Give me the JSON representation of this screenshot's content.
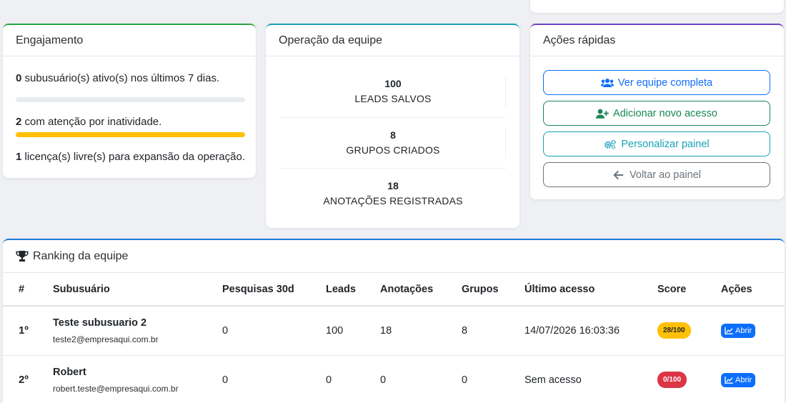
{
  "engagement": {
    "title": "Engajamento",
    "active": {
      "count": "0",
      "text": " subusuário(s) ativo(s) nos últimos 7 dias.",
      "progress": 0,
      "color": "#e9ecef"
    },
    "attention": {
      "count": "2",
      "text": " com atenção por inatividade.",
      "progress": 1,
      "color": "#ffc107"
    },
    "licenses": {
      "count": "1",
      "text": " licença(s) livre(s) para expansão da operação."
    }
  },
  "operation": {
    "title": "Operação da equipe",
    "stats": [
      {
        "value": "100",
        "label": "LEADS SALVOS"
      },
      {
        "value": "8",
        "label": "GRUPOS CRIADOS"
      },
      {
        "value": "18",
        "label": "ANOTAÇÕES REGISTRADAS"
      }
    ]
  },
  "actions": {
    "title": "Ações rápidas",
    "buttons": [
      {
        "label": "Ver equipe completa",
        "icon": "users-icon",
        "color": "#0d6efd"
      },
      {
        "label": "Adicionar novo acesso",
        "icon": "user-plus-icon",
        "color": "#198754"
      },
      {
        "label": "Personalizar painel",
        "icon": "cogs-icon",
        "color": "#17a2b8"
      },
      {
        "label": "Voltar ao painel",
        "icon": "arrow-left-icon",
        "color": "#6c757d"
      }
    ]
  },
  "ranking": {
    "title": "Ranking da equipe",
    "icon": "trophy-icon",
    "columns": [
      "#",
      "Subusuário",
      "Pesquisas 30d",
      "Leads",
      "Anotações",
      "Grupos",
      "Último acesso",
      "Score",
      "Ações"
    ],
    "rows": [
      {
        "pos": "1º",
        "name": "Teste subusuario 2",
        "email": "teste2@empresaqui.com.br",
        "searches": "0",
        "leads": "100",
        "notes": "18",
        "groups": "8",
        "last": "14/07/2026 16:03:36",
        "score": "28/100",
        "score_color": "#ffc107",
        "score_text_color": "#212529",
        "action": "Abrir"
      },
      {
        "pos": "2º",
        "name": "Robert",
        "email": "robert.teste@empresaqui.com.br",
        "searches": "0",
        "leads": "0",
        "notes": "0",
        "groups": "0",
        "last": "Sem acesso",
        "score": "0/100",
        "score_color": "#dc3545",
        "score_text_color": "#ffffff",
        "action": "Abrir"
      }
    ]
  }
}
